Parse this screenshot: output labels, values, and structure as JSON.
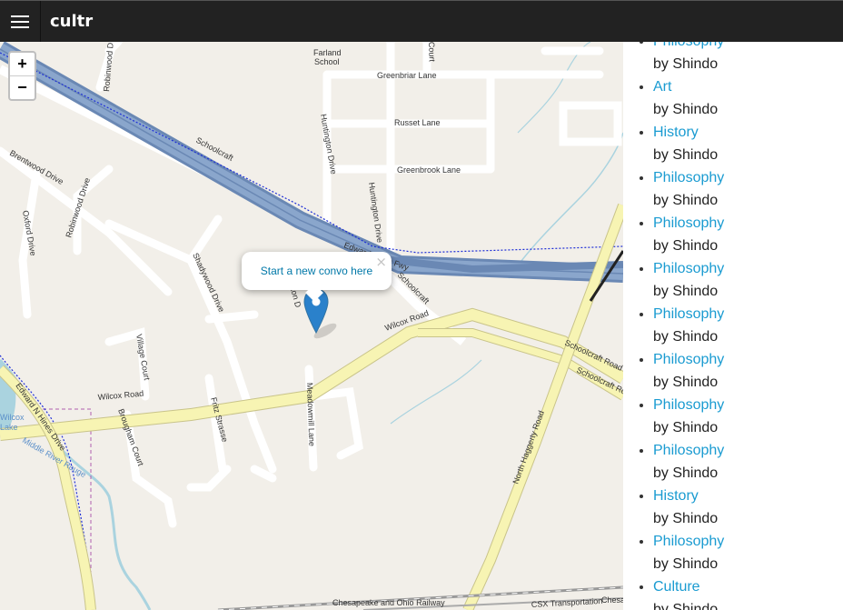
{
  "app": {
    "brand": "cultr"
  },
  "map": {
    "zoom_in": "+",
    "zoom_out": "−",
    "popup": {
      "text": "Start a new convo here",
      "close": "×"
    },
    "labels": {
      "farland_school_1": "Farland",
      "farland_school_2": "School",
      "greenbriar": "Greenbriar Lane",
      "russet": "Russet Lane",
      "greenbrook": "Greenbrook Lane",
      "huntington1": "Huntington Drive",
      "huntington2": "Huntington Drive",
      "schoolcraft1": "Schoolcraft",
      "schoolcraft2": "Schoolcraft",
      "schoolcraft_road1": "Schoolcraft Road",
      "schoolcraft_road2": "Schoolcraft Road",
      "brentwood": "Brentwood Drive",
      "robinwood1": "Robinwood Drive",
      "robinwood2": "Robinwood D",
      "oxford": "Oxford Drive",
      "shadywood": "Shadywood Drive",
      "wilcox1": "Wilcox Road",
      "wilcox2": "Wilcox Road",
      "village": "Village Court",
      "meadowmill": "Meadowmill Lane",
      "fritz": "Fritz Strasse",
      "brougham": "Brougham Court",
      "edward": "Edward N Hines Drive",
      "middle_river": "Middle River Rouge",
      "wilcox_lake1": "Wilcox",
      "wilcox_lake2": "Lake",
      "north_haggerty": "North Haggerty Road",
      "chesapeake": "Chesapeake and Ohio Railway",
      "csx": "CSX Transportation",
      "court": "Court",
      "fwy": "Edward Hines Fwy",
      "ton": "ton D",
      "ches": "Chesa"
    }
  },
  "sidebar": {
    "convos": [
      {
        "topic": "Philosophy",
        "author": "by Shindo"
      },
      {
        "topic": "Art",
        "author": "by Shindo"
      },
      {
        "topic": "History",
        "author": "by Shindo"
      },
      {
        "topic": "Philosophy",
        "author": "by Shindo"
      },
      {
        "topic": "Philosophy",
        "author": "by Shindo"
      },
      {
        "topic": "Philosophy",
        "author": "by Shindo"
      },
      {
        "topic": "Philosophy",
        "author": "by Shindo"
      },
      {
        "topic": "Philosophy",
        "author": "by Shindo"
      },
      {
        "topic": "Philosophy",
        "author": "by Shindo"
      },
      {
        "topic": "Philosophy",
        "author": "by Shindo"
      },
      {
        "topic": "History",
        "author": "by Shindo"
      },
      {
        "topic": "Philosophy",
        "author": "by Shindo"
      },
      {
        "topic": "Culture",
        "author": "by Shindo"
      }
    ]
  },
  "colors": {
    "topbar": "#222222",
    "map_bg": "#f2efe9",
    "highway": "#7e9ac0",
    "primary_road": "#f7f4b3",
    "link": "#1a9bd1",
    "marker": "#2a81cb"
  }
}
